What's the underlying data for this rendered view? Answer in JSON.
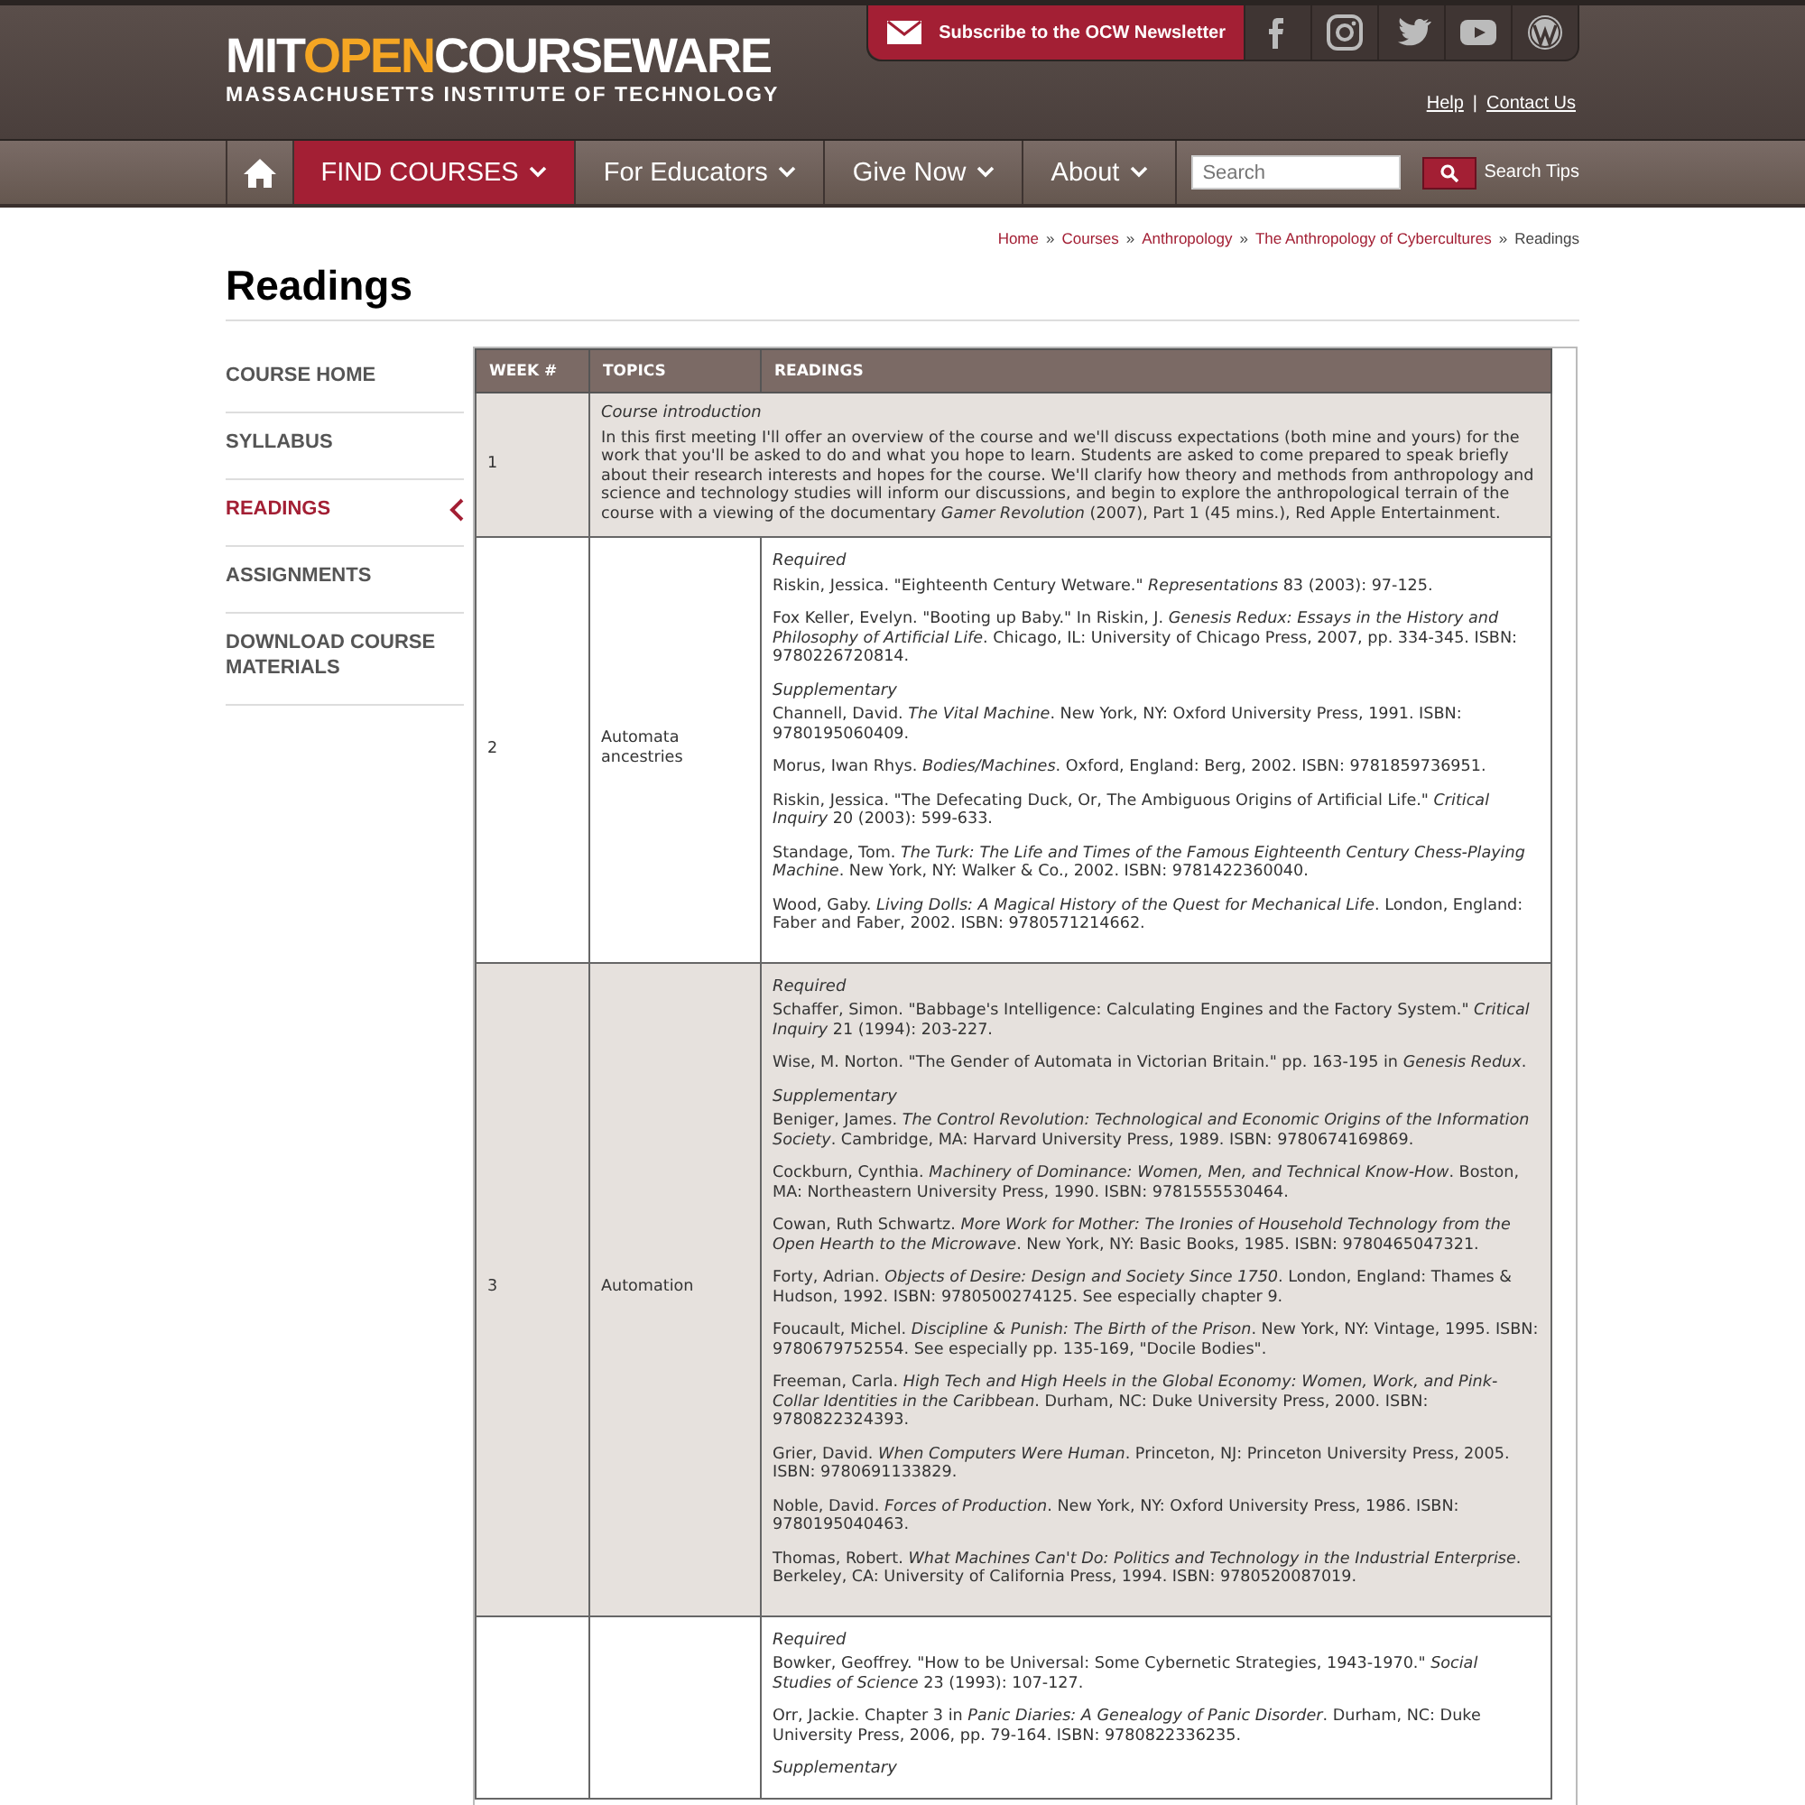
{
  "header": {
    "logo": {
      "prefix": "MIT",
      "highlight": "OPEN",
      "suffix": "COURSEWARE",
      "subtitle": "MASSACHUSETTS INSTITUTE OF TECHNOLOGY"
    },
    "newsletter": "Subscribe to the OCW Newsletter",
    "top_links": [
      {
        "kind": "link",
        "text": "Help"
      },
      {
        "kind": "separator",
        "text": "|"
      },
      {
        "kind": "link",
        "text": "Contact Us"
      }
    ]
  },
  "nav": {
    "items": [
      {
        "label": "FIND COURSES",
        "selected": true
      },
      {
        "label": "For Educators",
        "selected": false
      },
      {
        "label": "Give Now",
        "selected": false
      },
      {
        "label": "About",
        "selected": false
      }
    ],
    "search": {
      "placeholder": "Search"
    },
    "search_tips": "Search Tips"
  },
  "breadcrumb": [
    {
      "kind": "link",
      "text": "Home"
    },
    {
      "kind": "separator",
      "text": "»"
    },
    {
      "kind": "link",
      "text": "Courses"
    },
    {
      "kind": "separator",
      "text": "»"
    },
    {
      "kind": "link",
      "text": "Anthropology"
    },
    {
      "kind": "separator",
      "text": "»"
    },
    {
      "kind": "link",
      "text": "The Anthropology of Cybercultures"
    },
    {
      "kind": "separator",
      "text": "»"
    },
    {
      "kind": "current",
      "text": "Readings"
    }
  ],
  "page_title": "Readings",
  "sidebar": {
    "items": [
      {
        "label": "COURSE HOME",
        "selected": false
      },
      {
        "label": "SYLLABUS",
        "selected": false
      },
      {
        "label": "READINGS",
        "selected": true
      },
      {
        "label": "ASSIGNMENTS",
        "selected": false
      },
      {
        "label": "DOWNLOAD COURSE MATERIALS",
        "selected": false
      }
    ]
  },
  "table": {
    "columns": [
      "WEEK #",
      "TOPICS",
      "READINGS"
    ],
    "rows": [
      {
        "week": "1",
        "readings": {
          "kind": "intro",
          "title": "Course introduction",
          "text": "In this first meeting I'll offer an overview of the course and we'll discuss expectations (both mine and yours) for the work that you'll be asked to do and what you hope to learn. Students are asked to come prepared to speak briefly about their research interests and hopes for the course. We'll clarify how theory and methods from anthropology and science and technology studies will inform our discussions, and begin to explore the anthropological terrain of the course with a viewing of the documentary *Gamer Revolution* (2007), Part 1 (45 mins.), Red Apple Entertainment."
        }
      },
      {
        "week": "2",
        "topic": "Automata ancestries",
        "readings": {
          "kind": "sections",
          "sections": [
            {
              "heading": "Required",
              "entries": [
                "Riskin, Jessica. \"Eighteenth Century Wetware.\" *Representations* 83 (2003): 97-125.",
                "Fox Keller, Evelyn. \"Booting up Baby.\" In Riskin, J. *Genesis Redux: Essays in the History and Philosophy of Artificial Life*. Chicago, IL: University of Chicago Press, 2007, pp. 334-345. ISBN: 9780226720814."
              ]
            },
            {
              "heading": "Supplementary",
              "entries": [
                "Channell, David. *The Vital Machine*. New York, NY: Oxford University Press, 1991. ISBN: 9780195060409.",
                "Morus, Iwan Rhys. *Bodies/Machines*. Oxford, England: Berg, 2002. ISBN: 9781859736951.",
                "Riskin, Jessica. \"The Defecating Duck, Or, The Ambiguous Origins of Artificial Life.\" *Critical Inquiry* 20 (2003): 599-633.",
                "Standage, Tom. *The Turk: The Life and Times of the Famous Eighteenth Century Chess-Playing Machine*. New York, NY: Walker & Co., 2002. ISBN: 9781422360040.",
                "Wood, Gaby. *Living Dolls: A Magical History of the Quest for Mechanical Life*. London, England: Faber and Faber, 2002. ISBN: 9780571214662."
              ]
            }
          ]
        }
      },
      {
        "week": "3",
        "topic": "Automation",
        "readings": {
          "kind": "sections",
          "sections": [
            {
              "heading": "Required",
              "entries": [
                "Schaffer, Simon. \"Babbage's Intelligence: Calculating Engines and the Factory System.\" *Critical Inquiry* 21 (1994): 203-227.",
                "Wise, M. Norton. \"The Gender of Automata in Victorian Britain.\" pp. 163-195 in *Genesis Redux*."
              ]
            },
            {
              "heading": "Supplementary",
              "entries": [
                "Beniger, James. *The Control Revolution: Technological and Economic Origins of the Information Society*. Cambridge, MA: Harvard University Press, 1989. ISBN: 9780674169869.",
                "Cockburn, Cynthia. *Machinery of Dominance: Women, Men, and Technical Know-How*. Boston, MA: Northeastern University Press, 1990. ISBN: 9781555530464.",
                "Cowan, Ruth Schwartz. *More Work for Mother: The Ironies of Household Technology from the Open Hearth to the Microwave*. New York, NY: Basic Books, 1985. ISBN: 9780465047321.",
                "Forty, Adrian. *Objects of Desire: Design and Society Since 1750*. London, England: Thames & Hudson, 1992. ISBN: 9780500274125. See especially chapter 9.",
                "Foucault, Michel. *Discipline & Punish: The Birth of the Prison*. New York, NY: Vintage, 1995. ISBN: 9780679752554. See especially pp. 135-169, \"Docile Bodies\".",
                "Freeman, Carla. *High Tech and High Heels in the Global Economy: Women, Work, and Pink-Collar Identities in the Caribbean*. Durham, NC: Duke University Press, 2000. ISBN: 9780822324393.",
                "Grier, David. *When Computers Were Human*. Princeton, NJ: Princeton University Press, 2005. ISBN: 9780691133829.",
                "Noble, David. *Forces of Production*. New York, NY: Oxford University Press, 1986. ISBN: 9780195040463.",
                "Thomas, Robert. *What Machines Can't Do: Politics and Technology in the Industrial Enterprise*. Berkeley, CA: University of California Press, 1994. ISBN: 9780520087019."
              ]
            }
          ]
        }
      },
      {
        "readings": {
          "kind": "sections",
          "sections": [
            {
              "heading": "Required",
              "entries": [
                "Bowker, Geoffrey. \"How to be Universal: Some Cybernetic Strategies, 1943-1970.\" *Social Studies of Science* 23 (1993): 107-127.",
                "Orr, Jackie. Chapter 3 in *Panic Diaries: A Genealogy of Panic Disorder*. Durham, NC: Duke University Press, 2006, pp. 79-164. ISBN: 9780822336235."
              ]
            },
            {
              "heading": "Supplementary"
            }
          ]
        }
      }
    ]
  }
}
